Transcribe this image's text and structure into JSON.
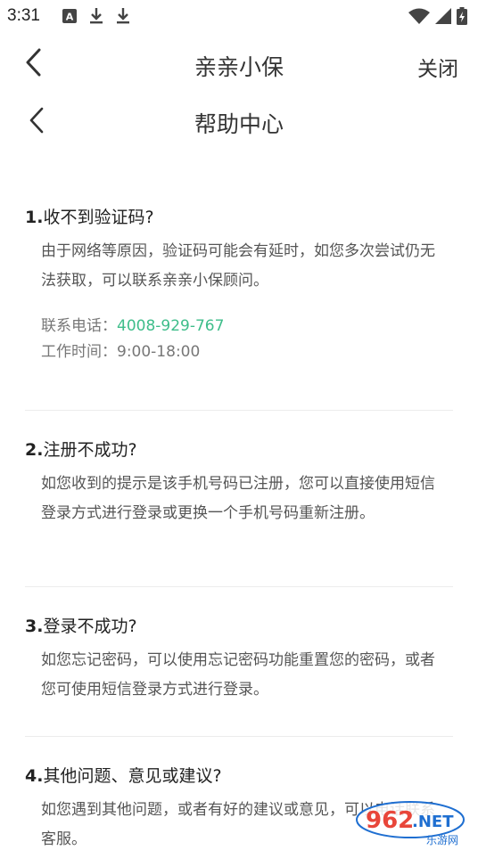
{
  "status_bar": {
    "time": "3:31",
    "left_icons": [
      "a-notification-icon",
      "download-icon",
      "download-icon"
    ],
    "right_icons": [
      "wifi-icon",
      "signal-icon",
      "battery-charging-icon"
    ]
  },
  "app_bar": {
    "title": "亲亲小保",
    "close_label": "关闭",
    "back_icon": "chevron-left-icon"
  },
  "sub_bar": {
    "title": "帮助中心",
    "back_icon": "chevron-left-icon"
  },
  "faq": [
    {
      "number": "1.",
      "question": "收不到验证码?",
      "answer": "由于网络等原因，验证码可能会有延时，如您多次尝试仍无法获取，可以联系亲亲小保顾问。",
      "phone_label": "联系电话：",
      "phone": "4008-929-767",
      "hours_label": "工作时间：",
      "hours": "9:00-18:00"
    },
    {
      "number": "2.",
      "question": "注册不成功?",
      "answer": "如您收到的提示是该手机号码已注册，您可以直接使用短信登录方式进行登录或更换一个手机号码重新注册。"
    },
    {
      "number": "3.",
      "question": "登录不成功?",
      "answer": "如您忘记密码，可以使用忘记密码功能重置您的密码，或者您可使用短信登录方式进行登录。"
    },
    {
      "number": "4.",
      "question": "其他问题、意见或建议?",
      "answer": "如您遇到其他问题，或者有好的建议或意见，可以电话联系客服。"
    }
  ],
  "watermark": {
    "brand": "962",
    "suffix": ".NET",
    "caption": "乐游网"
  },
  "colors": {
    "accent_green": "#3ebd8a",
    "watermark_red": "#e8463a",
    "watermark_blue": "#1f6fd1"
  }
}
